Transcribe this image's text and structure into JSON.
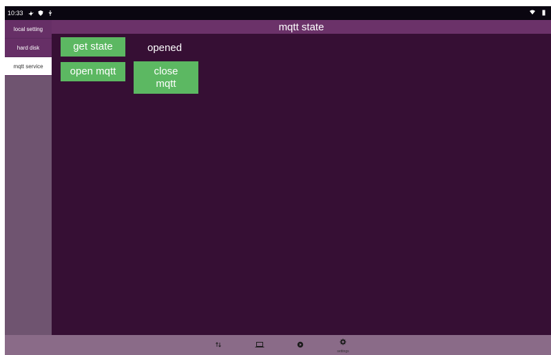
{
  "status_bar": {
    "time": "10:33"
  },
  "sidebar": {
    "items": [
      {
        "label": "local setting",
        "active": false
      },
      {
        "label": "hard disk",
        "active": false
      },
      {
        "label": "mqtt service",
        "active": true
      }
    ]
  },
  "header": {
    "title": "mqtt state"
  },
  "main": {
    "get_state_label": "get state",
    "state_value": "opened",
    "open_mqtt_label": "open mqtt",
    "close_mqtt_label": "close\nmqtt"
  },
  "bottom_nav": {
    "settings_label": "settings"
  },
  "colors": {
    "content_bg": "#360f34",
    "header_bg": "#6b3269",
    "button_green": "#5cb862",
    "sidebar_bg": "#6f5470",
    "nav_bg": "#8a6b88"
  }
}
